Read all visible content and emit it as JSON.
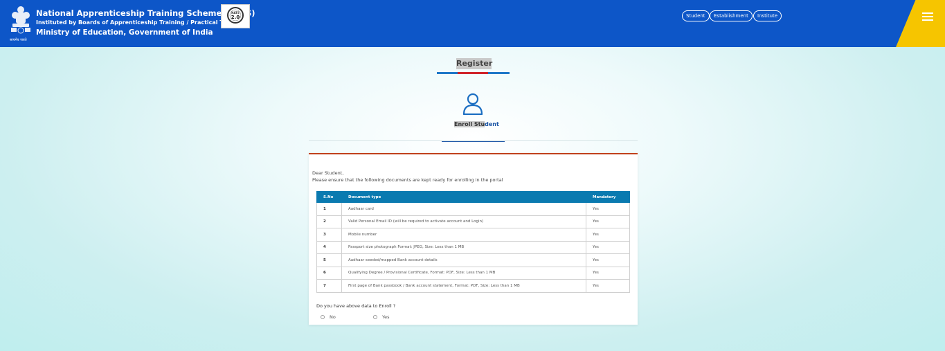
{
  "header": {
    "title": "National Apprenticeship Training Scheme (NATS)",
    "subtitle": "Instituted by Boards of Apprenticeship Training / Practical Training",
    "ministry": "Ministry of Education, Government of India",
    "emblem_caption": "सत्यमेव जयते",
    "badge_text": "NATS",
    "badge_version": "2.0",
    "nav": [
      "Student",
      "Establishment",
      "Institute"
    ]
  },
  "register": {
    "title": "Register",
    "enroll_highlight": "Enroll Stu",
    "enroll_rest": "dent"
  },
  "card": {
    "greeting": "Dear Student,",
    "instruction": "Please ensure that the following documents are kept ready for enrolling in the portal",
    "table": {
      "headers": [
        "S.No",
        "Document type",
        "Mandatory"
      ],
      "rows": [
        [
          "1",
          "Aadhaar card",
          "Yes"
        ],
        [
          "2",
          "Valid Personal Email ID (will be required to activate account and Login)",
          "Yes"
        ],
        [
          "3",
          "Mobile number",
          "Yes"
        ],
        [
          "4",
          "Passport size photograph Format: JPEG, Size: Less than 1 MB",
          "Yes"
        ],
        [
          "5",
          "Aadhaar seeded/mapped Bank account details",
          "Yes"
        ],
        [
          "6",
          "Qualifying Degree / Provisional Certificate, Format: PDF, Size: Less than 1 MB",
          "Yes"
        ],
        [
          "7",
          "First page of Bank passbook / Bank account statement, Format: PDF, Size: Less than 1 MB",
          "Yes"
        ]
      ]
    },
    "question": "Do you have above data to Enroll ?",
    "options": [
      "No",
      "Yes"
    ]
  },
  "icons": [
    "emblem-icon",
    "user-icon",
    "hamburger-icon"
  ],
  "colors": {
    "header": "#0d56c8",
    "accent_yellow": "#f6c500",
    "table_header": "#0a7ab0",
    "card_border": "#c0411c"
  }
}
